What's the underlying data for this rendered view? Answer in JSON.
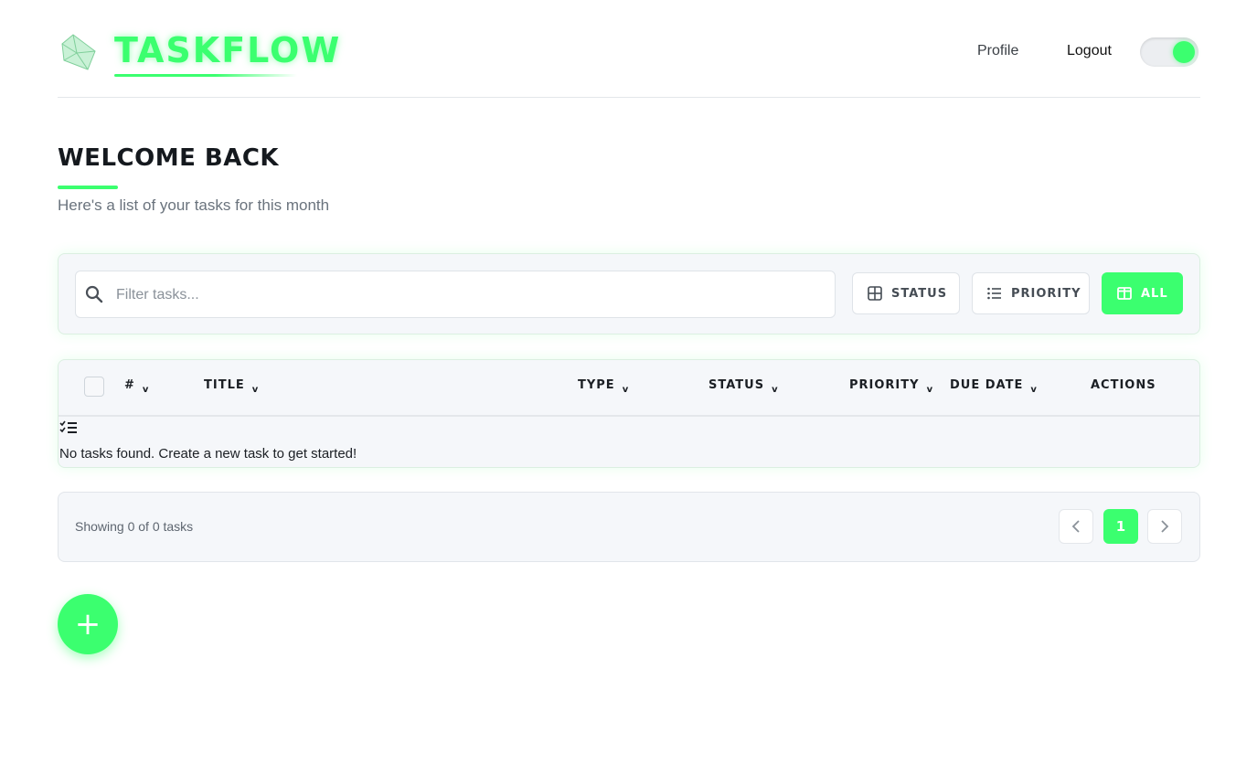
{
  "header": {
    "brand": "TASKFLOW",
    "logo_icon": "crystal-icon",
    "nav": {
      "profile": "Profile",
      "logout": "Logout"
    },
    "theme_toggle": {
      "on": true
    }
  },
  "welcome": {
    "title": "WELCOME BACK",
    "subtitle": "Here's a list of your tasks for this month"
  },
  "filters": {
    "search_placeholder": "Filter tasks...",
    "status_label": "STATUS",
    "status_icon": "grid-icon",
    "priority_label": "PRIORITY",
    "priority_icon": "list-icon",
    "all_label": "ALL",
    "all_icon": "columns-icon",
    "active": "ALL"
  },
  "table": {
    "columns": [
      "#",
      "TITLE",
      "TYPE",
      "STATUS",
      "PRIORITY",
      "DUE DATE",
      "ACTIONS"
    ],
    "sortable": [
      true,
      true,
      true,
      true,
      true,
      true,
      false
    ],
    "rows": [],
    "empty_icon": "checklist-icon",
    "empty_message": "No tasks found. Create a new task to get started!"
  },
  "pagination": {
    "info": "Showing 0 of 0 tasks",
    "current_page": "1"
  },
  "fab": {
    "label": "+"
  },
  "colors": {
    "accent": "#3bff6f",
    "text": "#1b1f24",
    "muted": "#6a737d",
    "panel": "#f5f7fa"
  }
}
